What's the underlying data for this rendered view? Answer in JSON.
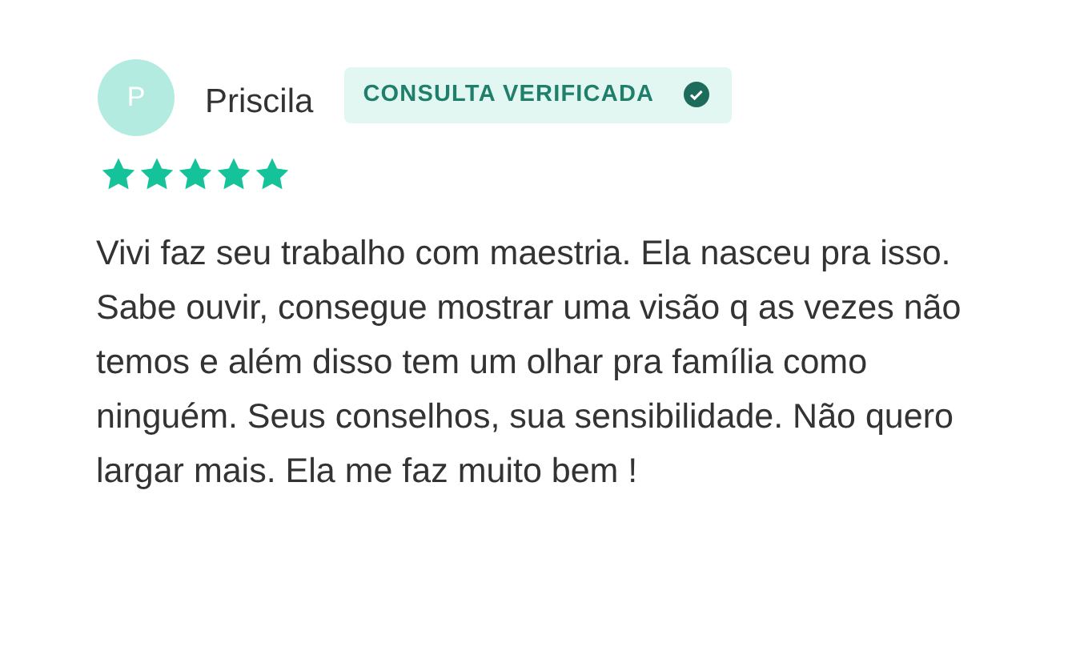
{
  "review": {
    "avatar_initial": "P",
    "author": "Priscila",
    "badge": "CONSULTA VERIFICADA",
    "stars": 5,
    "text": "Vivi faz seu trabalho com maestria. Ela nasceu pra isso. Sabe ouvir, consegue mostrar uma visão q as vezes não temos e além disso tem um olhar pra família como ninguém. Seus conselhos, sua sensibilidade. Não quero largar mais. Ela me faz muito bem !"
  }
}
